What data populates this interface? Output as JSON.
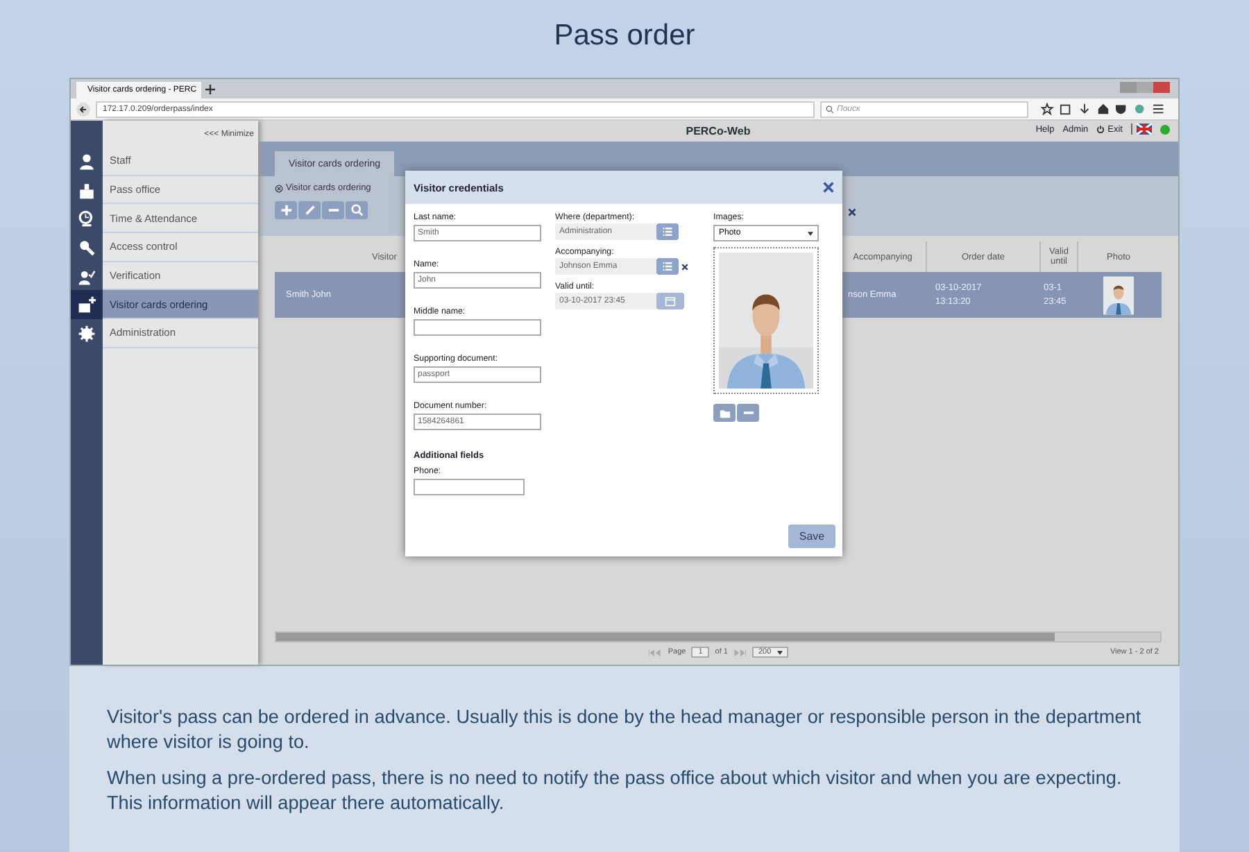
{
  "page_title": "Pass order",
  "browser": {
    "tab_title": "Visitor cards ordering - PERC",
    "url": "172.17.0.209/orderpass/index",
    "search_placeholder": "Поиск"
  },
  "app": {
    "minimize": "<<< Minimize",
    "brand": "PERCo-Web",
    "header_links": [
      "Help",
      "Admin",
      "Exit"
    ],
    "online": true
  },
  "sidebar": [
    {
      "label": "Staff",
      "kind": "person",
      "selected": false
    },
    {
      "label": "Pass office",
      "kind": "badge",
      "selected": false
    },
    {
      "label": "Time & Attendance",
      "kind": "clock",
      "selected": false
    },
    {
      "label": "Access control",
      "kind": "key",
      "selected": false
    },
    {
      "label": "Verification",
      "kind": "check",
      "selected": false
    },
    {
      "label": "Visitor cards ordering",
      "kind": "plus",
      "selected": true
    },
    {
      "label": "Administration",
      "kind": "gear",
      "selected": false
    }
  ],
  "tab": {
    "label": "Visitor cards ordering",
    "selected": true
  },
  "breadcrumb": "Visitor cards ordering",
  "grid": {
    "columns": [
      "Visitor",
      "Accompanying",
      "Order date",
      "Valid until",
      "Photo"
    ],
    "rows": [
      {
        "selected": true,
        "cells": [
          "Smith John",
          "nson Emma",
          "03-10-2017 13:13:20",
          "03-1 23:45"
        ]
      }
    ]
  },
  "modal": {
    "title": "Visitor credentials",
    "left_fields": [
      {
        "label": "Last name:",
        "value": "Smith"
      },
      {
        "label": "Name:",
        "value": "John"
      },
      {
        "label": "Middle name:"
      },
      {
        "label": "Supporting document:",
        "value": "passport"
      },
      {
        "label": "Document number:",
        "value": "1584264861"
      }
    ],
    "additional_heading": "Additional fields",
    "extra_fields": [
      {
        "label": "Phone:"
      }
    ],
    "middle_fields": [
      {
        "label": "Where (department):",
        "value": "Administration",
        "kind": "list",
        "clearable": false
      },
      {
        "label": "Accompanying:",
        "value": "Johnson Emma",
        "kind": "list",
        "clearable": true
      },
      {
        "label": "Valid until:",
        "value": "03-10-2017 23:45",
        "kind": "calendar",
        "clearable": false
      }
    ],
    "images_label": "Images:",
    "images_value": "Photo",
    "save": "Save"
  },
  "pager": {
    "page_label": "Page",
    "page": "1",
    "of": "of 1",
    "size": "200",
    "view": "View 1 - 2 of 2"
  },
  "description": [
    "Visitor's pass can be ordered in advance. Usually this is done by the head manager or responsible person in the department where visitor is going to.",
    "When using a pre-ordered pass, there is no need to notify the pass office about which visitor and when you are expecting. This information will appear there automatically."
  ]
}
